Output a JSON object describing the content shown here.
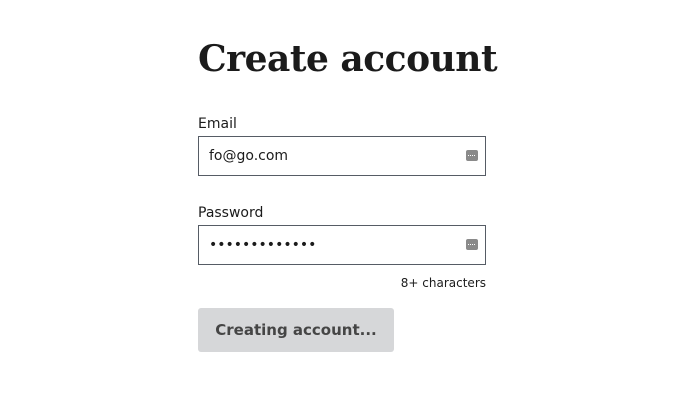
{
  "page": {
    "title": "Create account"
  },
  "form": {
    "email_label": "Email",
    "email_value": "fo@go.com",
    "password_label": "Password",
    "password_value": "1234567890123",
    "password_hint": "8+ characters",
    "submit_label": "Creating account..."
  },
  "icons": {
    "field_icon": "password-manager-key-icon"
  }
}
